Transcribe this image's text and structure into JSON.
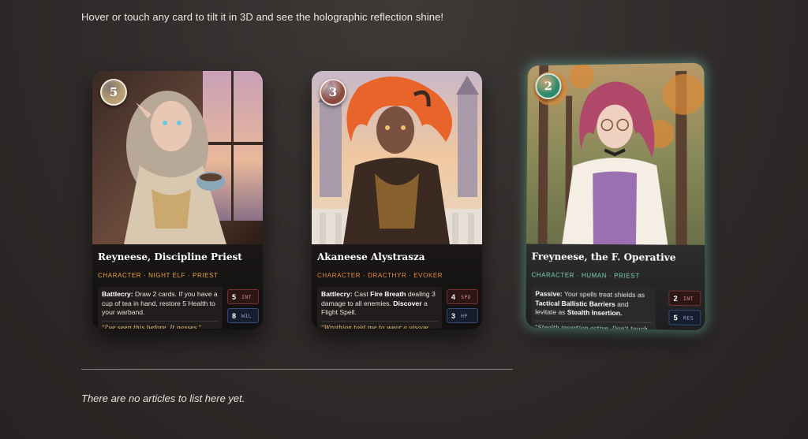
{
  "intro": "Hover or touch any card to tilt it in 3D and see the holographic reflection shine!",
  "cards": [
    {
      "cost": "5",
      "name": "Reyneese, Discipline Priest",
      "tags": "CHARACTER · NIGHT ELF · PRIEST",
      "tag_color": "#e8a442",
      "cost_color": "#b9a173",
      "ability_keyword": "Battlecry:",
      "ability_text": "Draw 2 cards. If you have a cup of tea in hand, restore 5 Health to your warband.",
      "flavor": "\"I've seen this before. It passes.\"",
      "stats": [
        {
          "value": "5",
          "label": "INT",
          "style": "red"
        },
        {
          "value": "8",
          "label": "WIL",
          "style": "blue"
        }
      ]
    },
    {
      "cost": "3",
      "name": "Akaneese Alystrasza",
      "tags": "CHARACTER · DRACTHYR · EVOKER",
      "tag_color": "#e8893e",
      "cost_color": "#8a4a3c",
      "ability_keyword": "Battlecry:",
      "ability_pre": "Cast",
      "ability_bold1": "Fire Breath",
      "ability_mid": "dealing 3 damage to all enemies.",
      "ability_bold2": "Discover",
      "ability_post": "a Flight Spell.",
      "flavor": "\"Wrathion told me to wear a visage,",
      "stats": [
        {
          "value": "4",
          "label": "SPD",
          "style": "red"
        },
        {
          "value": "3",
          "label": "HP",
          "style": "blue"
        }
      ]
    },
    {
      "cost": "2",
      "name": "Freyneese, the F. Operative",
      "tags": "CHARACTER · HUMAN · PRIEST",
      "tag_color": "#7cd3b8",
      "cost_color": "#2a8a6a",
      "ability_keyword": "Passive:",
      "ability_pre": "Your spells treat shields as",
      "ability_bold1": "Tactical Ballistic Barriers",
      "ability_mid": "and levitate as",
      "ability_bold2": "Stealth Insertion.",
      "flavor": "\"Stealth insertion active. Don't touch",
      "stats": [
        {
          "value": "2",
          "label": "INT",
          "style": "red"
        },
        {
          "value": "5",
          "label": "RES",
          "style": "blue"
        }
      ]
    }
  ],
  "empty_message": "There are no articles to list here yet."
}
